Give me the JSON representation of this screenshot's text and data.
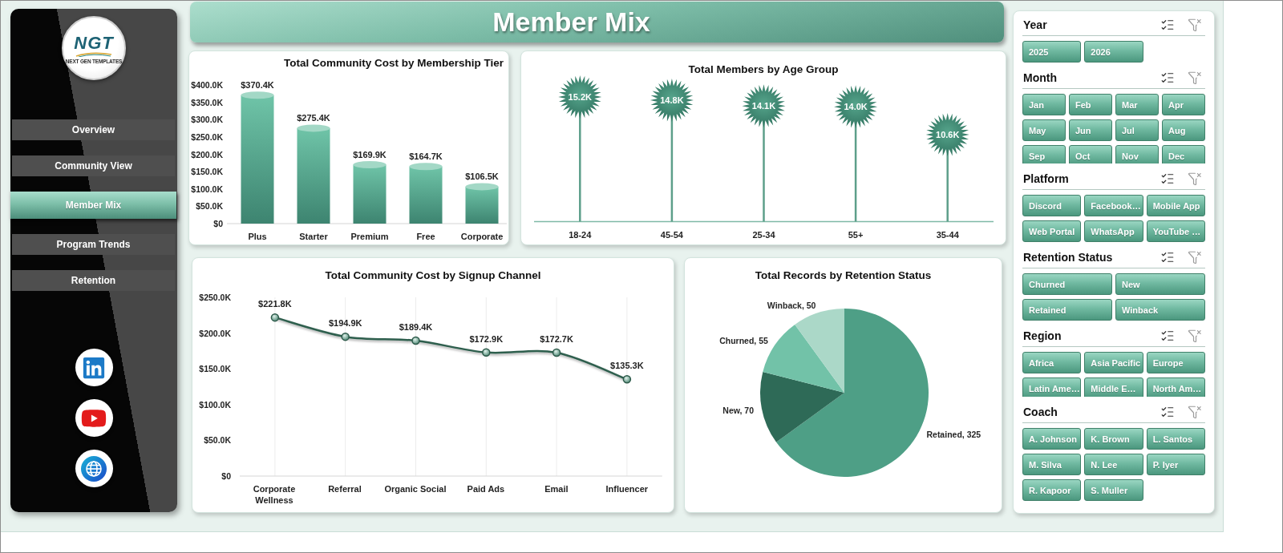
{
  "sidebar": {
    "logo": {
      "mark": "NGT",
      "tagline": "NEXT GEN TEMPLATES"
    },
    "nav": [
      {
        "label": "Overview",
        "selected": false
      },
      {
        "label": "Community View",
        "selected": false
      },
      {
        "label": "Member Mix",
        "selected": true
      },
      {
        "label": "Program Trends",
        "selected": false
      },
      {
        "label": "Retention",
        "selected": false
      }
    ],
    "social": [
      {
        "kind": "linkedin"
      },
      {
        "kind": "youtube"
      },
      {
        "kind": "website"
      }
    ]
  },
  "header": {
    "title": "Member Mix"
  },
  "cost_by_tier": {
    "chart_data": {
      "type": "bar",
      "title": "Total Community Cost by Membership Tier",
      "categories": [
        "Plus",
        "Starter",
        "Premium",
        "Free",
        "Corporate"
      ],
      "values": [
        370400,
        275400,
        169900,
        164700,
        106500
      ],
      "ylim": [
        0,
        400000
      ],
      "yticks": [
        {
          "value": 0,
          "label": "$0"
        },
        {
          "value": 50000,
          "label": "$50.0K"
        },
        {
          "value": 100000,
          "label": "$100.0K"
        },
        {
          "value": 150000,
          "label": "$150.0K"
        },
        {
          "value": 200000,
          "label": "$200.0K"
        },
        {
          "value": 250000,
          "label": "$250.0K"
        },
        {
          "value": 300000,
          "label": "$300.0K"
        },
        {
          "value": 350000,
          "label": "$350.0K"
        },
        {
          "value": 400000,
          "label": "$400.0K"
        }
      ],
      "value_labels": [
        "$370.4K",
        "$275.4K",
        "$169.9K",
        "$164.7K",
        "$106.5K"
      ]
    }
  },
  "members_by_age": {
    "title": "Total Members by Age Group",
    "groups": [
      {
        "label": "18-24",
        "count": "15.2K"
      },
      {
        "label": "45-54",
        "count": "14.8K"
      },
      {
        "label": "25-34",
        "count": "14.1K"
      },
      {
        "label": "55+",
        "count": "14.0K"
      },
      {
        "label": "35-44",
        "count": "10.6K"
      }
    ]
  },
  "cost_by_channel": {
    "chart_data": {
      "type": "line",
      "title": "Total Community Cost by Signup Channel",
      "categories": [
        "Corporate Wellness",
        "Referral",
        "Organic Social",
        "Paid Ads",
        "Email",
        "Influencer"
      ],
      "values": [
        221800,
        194900,
        189400,
        172900,
        172700,
        135300
      ],
      "ylim": [
        0,
        250000
      ],
      "yticks": [
        {
          "value": 0,
          "label": "$0"
        },
        {
          "value": 50000,
          "label": "$50.0K"
        },
        {
          "value": 100000,
          "label": "$100.0K"
        },
        {
          "value": 150000,
          "label": "$150.0K"
        },
        {
          "value": 200000,
          "label": "$200.0K"
        },
        {
          "value": 250000,
          "label": "$250.0K"
        }
      ],
      "grid": true,
      "marker": "circle",
      "value_labels": [
        "$221.8K",
        "$194.9K",
        "$189.4K",
        "$172.9K",
        "$172.7K",
        "$135.3K"
      ]
    }
  },
  "records_by_retention": {
    "chart_data": {
      "type": "pie",
      "title": "Total Records by Retention Status",
      "values": [
        325,
        70,
        55,
        50
      ],
      "value_labels": [
        "Retained, 325",
        "New, 70",
        "Churned, 55",
        "Winback, 50"
      ]
    }
  },
  "slicers": [
    {
      "title": "Year",
      "items": [
        {
          "label": "2025",
          "selected": true
        },
        {
          "label": "2026",
          "selected": true
        }
      ]
    },
    {
      "title": "Month",
      "items": [
        {
          "label": "Jan",
          "selected": true
        },
        {
          "label": "Feb",
          "selected": true
        },
        {
          "label": "Mar",
          "selected": true
        },
        {
          "label": "Apr",
          "selected": true
        },
        {
          "label": "May",
          "selected": true
        },
        {
          "label": "Jun",
          "selected": true
        },
        {
          "label": "Jul",
          "selected": true
        },
        {
          "label": "Aug",
          "selected": true
        },
        {
          "label": "Sep",
          "selected": true
        },
        {
          "label": "Oct",
          "selected": true
        },
        {
          "label": "Nov",
          "selected": true
        },
        {
          "label": "Dec",
          "selected": true
        }
      ]
    },
    {
      "title": "Platform",
      "items": [
        {
          "label": "Discord",
          "selected": true
        },
        {
          "label": "Facebook…",
          "selected": true
        },
        {
          "label": "Mobile App",
          "selected": true
        },
        {
          "label": "Web Portal",
          "selected": true
        },
        {
          "label": "WhatsApp",
          "selected": true
        },
        {
          "label": "YouTube …",
          "selected": true
        }
      ]
    },
    {
      "title": "Retention Status",
      "items": [
        {
          "label": "Churned",
          "selected": true
        },
        {
          "label": "New",
          "selected": true
        },
        {
          "label": "Retained",
          "selected": true
        },
        {
          "label": "Winback",
          "selected": true
        }
      ]
    },
    {
      "title": "Region",
      "items": [
        {
          "label": "Africa",
          "selected": true
        },
        {
          "label": "Asia Pacific",
          "selected": true
        },
        {
          "label": "Europe",
          "selected": true
        },
        {
          "label": "Latin Ame…",
          "selected": true
        },
        {
          "label": "Middle E…",
          "selected": true
        },
        {
          "label": "North Am…",
          "selected": true
        }
      ]
    },
    {
      "title": "Coach",
      "items": [
        {
          "label": "A. Johnson",
          "selected": true
        },
        {
          "label": "K. Brown",
          "selected": true
        },
        {
          "label": "L. Santos",
          "selected": true
        },
        {
          "label": "M. Silva",
          "selected": true
        },
        {
          "label": "N. Lee",
          "selected": true
        },
        {
          "label": "P. Iyer",
          "selected": true
        },
        {
          "label": "R. Kapoor",
          "selected": true
        },
        {
          "label": "S. Muller",
          "selected": true
        }
      ]
    }
  ]
}
